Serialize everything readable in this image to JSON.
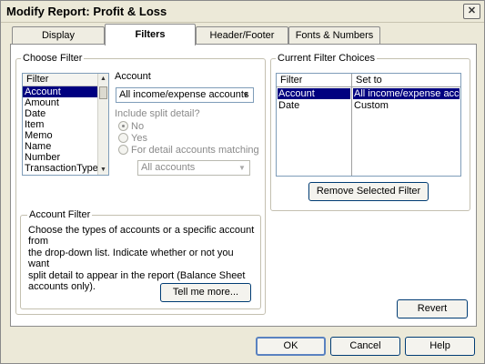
{
  "window": {
    "title": "Modify Report: Profit & Loss",
    "close_glyph": "✕"
  },
  "tabs": [
    {
      "label": "Display"
    },
    {
      "label": "Filters"
    },
    {
      "label": "Header/Footer"
    },
    {
      "label": "Fonts & Numbers"
    }
  ],
  "choose_filter": {
    "group_label": "Choose Filter",
    "list_header": "Filter",
    "items": [
      "Account",
      "Amount",
      "Date",
      "Item",
      "Memo",
      "Name",
      "Number",
      "TransactionType"
    ],
    "selected_index": 0,
    "account_label": "Account",
    "account_value": "All income/expense accounts",
    "include_split_label": "Include split detail?",
    "radio_no": "No",
    "radio_yes": "Yes",
    "radio_detail": "For detail accounts matching",
    "detail_combo_value": "All accounts"
  },
  "account_filter": {
    "group_label": "Account Filter",
    "description_lines": [
      "Choose the types of accounts or a specific account from",
      "the drop-down list. Indicate whether or not you want",
      "split detail to appear in the report (Balance Sheet",
      "accounts only)."
    ],
    "tell_me_more": "Tell me more..."
  },
  "current_filters": {
    "group_label": "Current Filter Choices",
    "col_filter": "Filter",
    "col_set_to": "Set to",
    "rows": [
      {
        "filter": "Account",
        "set_to": "All income/expense acc..."
      },
      {
        "filter": "Date",
        "set_to": "Custom"
      }
    ],
    "remove_button": "Remove Selected Filter"
  },
  "buttons": {
    "revert": "Revert",
    "ok": "OK",
    "cancel": "Cancel",
    "help": "Help"
  }
}
